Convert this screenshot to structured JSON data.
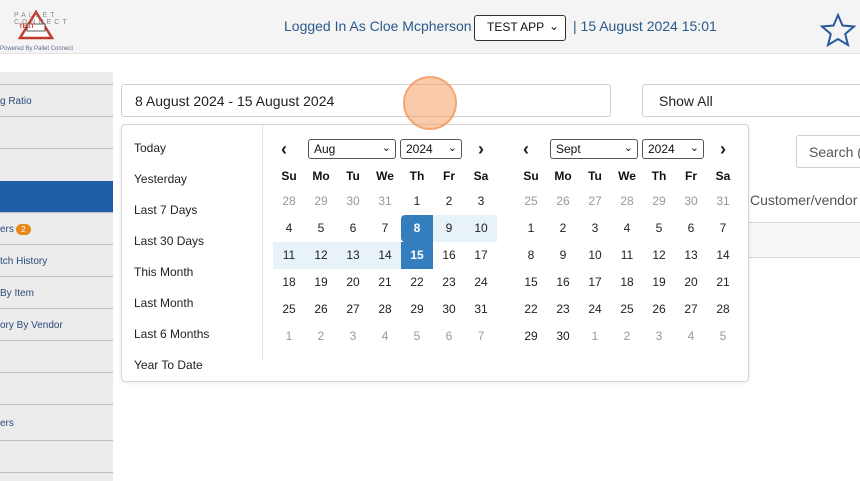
{
  "header": {
    "logo_text": "PALLET CONNECT",
    "logo_badge": "TEST",
    "powered": "Powered By Pallet Connect",
    "logged_in": "Logged In As Cloe Mcpherson |",
    "app_select": "TEST APP",
    "datetime": "| 15 August 2024 15:01",
    "star_icon": "star-icon"
  },
  "sidebar": {
    "items": [
      {
        "label": ""
      },
      {
        "label": "g Ratio"
      },
      {
        "label": ""
      },
      {
        "label": "",
        "active": true
      },
      {
        "label": "ers",
        "badge": "2"
      },
      {
        "label": "tch History"
      },
      {
        "label": "By Item"
      },
      {
        "label": "ory By Vendor"
      },
      {
        "label": ""
      },
      {
        "label": ""
      },
      {
        "label": "ers"
      },
      {
        "label": ""
      }
    ]
  },
  "filters": {
    "date_range": "8 August 2024 - 15 August 2024",
    "show_all": "Show All",
    "search": "Search (",
    "customer_vendor": "Customer/vendor"
  },
  "picker": {
    "ranges": [
      "Today",
      "Yesterday",
      "Last 7 Days",
      "Last 30 Days",
      "This Month",
      "Last Month",
      "Last 6 Months",
      "Year To Date"
    ],
    "weekdays": [
      "Su",
      "Mo",
      "Tu",
      "We",
      "Th",
      "Fr",
      "Sa"
    ],
    "left": {
      "month": "Aug",
      "year": "2024",
      "weeks": [
        [
          "28",
          "29",
          "30",
          "31",
          "1",
          "2",
          "3"
        ],
        [
          "4",
          "5",
          "6",
          "7",
          "8",
          "9",
          "10"
        ],
        [
          "11",
          "12",
          "13",
          "14",
          "15",
          "16",
          "17"
        ],
        [
          "18",
          "19",
          "20",
          "21",
          "22",
          "23",
          "24"
        ],
        [
          "25",
          "26",
          "27",
          "28",
          "29",
          "30",
          "31"
        ],
        [
          "1",
          "2",
          "3",
          "4",
          "5",
          "6",
          "7"
        ]
      ]
    },
    "right": {
      "month": "Sept",
      "year": "2024",
      "weeks": [
        [
          "25",
          "26",
          "27",
          "28",
          "29",
          "30",
          "31"
        ],
        [
          "1",
          "2",
          "3",
          "4",
          "5",
          "6",
          "7"
        ],
        [
          "8",
          "9",
          "10",
          "11",
          "12",
          "13",
          "14"
        ],
        [
          "15",
          "16",
          "17",
          "18",
          "19",
          "20",
          "21"
        ],
        [
          "22",
          "23",
          "24",
          "25",
          "26",
          "27",
          "28"
        ],
        [
          "29",
          "30",
          "1",
          "2",
          "3",
          "4",
          "5"
        ]
      ]
    },
    "prev_icon": "chevron-left-icon",
    "next_icon": "chevron-right-icon"
  }
}
